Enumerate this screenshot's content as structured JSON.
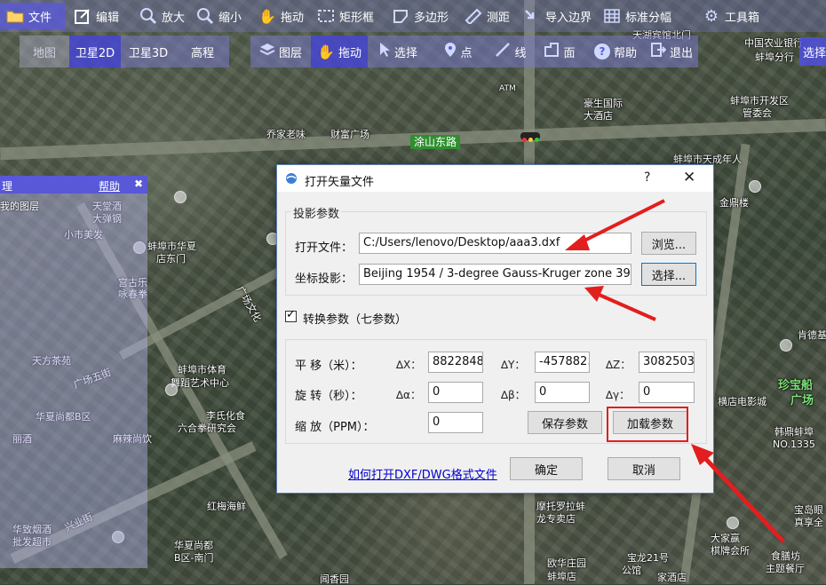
{
  "toolbar1": {
    "items": [
      {
        "label": "文件",
        "icon": "folder-icon"
      },
      {
        "label": "编辑",
        "icon": "edit-icon"
      },
      {
        "label": "放大",
        "icon": "zoom-in-icon"
      },
      {
        "label": "缩小",
        "icon": "zoom-out-icon"
      },
      {
        "label": "拖动",
        "icon": "hand-icon"
      },
      {
        "label": "矩形框",
        "icon": "rectangle-icon"
      },
      {
        "label": "多边形",
        "icon": "polygon-icon"
      },
      {
        "label": "测距",
        "icon": "ruler-icon"
      },
      {
        "label": "导入边界",
        "icon": "import-icon"
      },
      {
        "label": "标准分幅",
        "icon": "grid-icon"
      },
      {
        "label": "工具箱",
        "icon": "gear-icon"
      }
    ]
  },
  "toolbar2": {
    "map_tabs": [
      "地图",
      "卫星2D",
      "卫星3D",
      "高程"
    ],
    "active_tab": "卫星2D",
    "tools": [
      {
        "label": "图层",
        "icon": "layers-icon"
      },
      {
        "label": "拖动",
        "icon": "hand-icon"
      },
      {
        "label": "选择",
        "icon": "cursor-icon"
      },
      {
        "label": "点",
        "icon": "pin-icon"
      },
      {
        "label": "线",
        "icon": "line-icon"
      },
      {
        "label": "面",
        "icon": "area-icon"
      },
      {
        "label": "帮助",
        "icon": "help-icon"
      },
      {
        "label": "退出",
        "icon": "exit-icon"
      }
    ],
    "select_tab": "选择"
  },
  "left_panel": {
    "title_fragment": "理",
    "help": "帮助",
    "close": "✖",
    "sub": "我的图层"
  },
  "dialog": {
    "title": "打开矢量文件",
    "help_glyph": "?",
    "close_glyph": "✕",
    "projection_group": "投影参数",
    "open_file_label": "打开文件：",
    "open_file_value": "C:/Users/lenovo/Desktop/aaa3.dxf",
    "browse_button": "浏览...",
    "coord_label": "坐标投影：",
    "coord_value": "Beijing 1954 / 3-degree Gauss-Kruger zone 39",
    "select_button": "选择...",
    "transform_checkbox": "转换参数（七参数）",
    "transform_checked": true,
    "translation_label": "平 移（米）：",
    "rotation_label": "旋 转（秒）：",
    "scale_label": "缩 放（PPM）：",
    "dx_label": "∆X：",
    "dx_value": "8822848",
    "dy_label": "∆Y：",
    "dy_value": "-457882.5",
    "dz_label": "∆Z：",
    "dz_value": "3082503",
    "alpha_label": "∆α：",
    "alpha_value": "0",
    "beta_label": "∆β：",
    "beta_value": "0",
    "gamma_label": "∆γ：",
    "gamma_value": "0",
    "scale_value": "0",
    "save_button": "保存参数",
    "load_button": "加载参数",
    "help_link": "如何打开DXF/DWG格式文件",
    "ok_button": "确定",
    "cancel_button": "取消"
  },
  "map_labels": [
    "涂山东路",
    "天湖宾馆北门",
    "中国农业银行",
    "蚌埠分行",
    "豪生国际",
    "大酒店",
    "蚌埠市开发区",
    "管委会",
    "蚌埠市天成年人",
    "乔家老味",
    "财富广场",
    "ATM",
    "天堂酒",
    "大弹钢",
    "小市美发",
    "宫古乐",
    "咏春拳",
    "蚌埠市华夏",
    "店东门",
    "蚌埠市体育",
    "舞蹈艺术中心",
    "李氏化食",
    "六合拳研究会",
    "华夏尚都B区",
    "麻辣尚饮",
    "广场五街",
    "红梅海鲜",
    "华夏尚都",
    "B区-南门",
    "华致烟酒",
    "批发超市",
    "兴业街",
    "摩托罗拉蚌",
    "龙专卖店",
    "欧华庄园",
    "宝龙21号",
    "公馆",
    "蚌埠店",
    "珍宝船",
    "广场",
    "韩鼎蚌埠",
    "NO.1335",
    "横店电影城",
    "肯德基",
    "金鼎楼",
    "宝岛眼",
    "真享全",
    "大家赢",
    "棋牌会所",
    "食膳坊",
    "主题餐厅",
    "家酒店",
    "闻香园",
    "天方茶苑",
    "广场文化",
    "丽酒"
  ]
}
